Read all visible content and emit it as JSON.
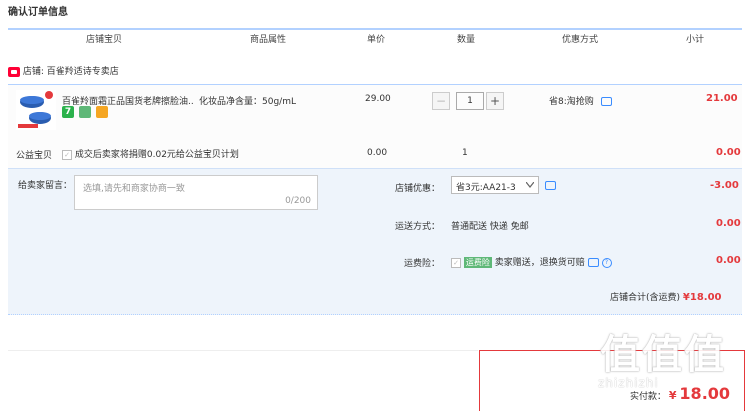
{
  "page_title": "确认订单信息",
  "columns": [
    "店铺宝贝",
    "商品属性",
    "单价",
    "数量",
    "优惠方式",
    "小计"
  ],
  "store": {
    "label": "店铺:",
    "name": "百雀羚适诗专卖店"
  },
  "item": {
    "name": "百雀羚面霜正品国货老牌擦脸油...",
    "attribute": "化妆品净含量：50g/mL",
    "price": "29.00",
    "quantity": "1",
    "minus": "−",
    "plus": "+",
    "discount": "省8:淘抢购",
    "subtotal": "21.00",
    "badge_seven": "7"
  },
  "charity": {
    "label": "公益宝贝",
    "text": "成交后卖家将捐赠0.02元给公益宝贝计划",
    "price": "0.00",
    "quantity": "1",
    "subtotal": "0.00"
  },
  "message": {
    "label": "给卖家留言：",
    "placeholder": "选填,请先和商家协商一致",
    "counter": "0/200"
  },
  "coupon": {
    "label": "店铺优惠：",
    "selected": "省3元:AA21-3",
    "amount": "-3.00"
  },
  "shipping": {
    "label": "运送方式：",
    "value": "普通配送 快递 免邮",
    "amount": "0.00"
  },
  "insurance": {
    "label": "运费险：",
    "tag": "运费险",
    "text": "卖家赠送，退换货可赔",
    "amount": "0.00"
  },
  "store_total": {
    "label": "店铺合计(含运费)",
    "amount": "¥18.00"
  },
  "final": {
    "label": "实付款：",
    "amount": "18.00",
    "currency": "¥"
  },
  "watermark": {
    "main": "值",
    "sub": "zhizhizhi"
  },
  "colors": {
    "accent_red": "#e4393c",
    "header_line": "#b2d1ff",
    "link_blue": "#3a8cff"
  }
}
